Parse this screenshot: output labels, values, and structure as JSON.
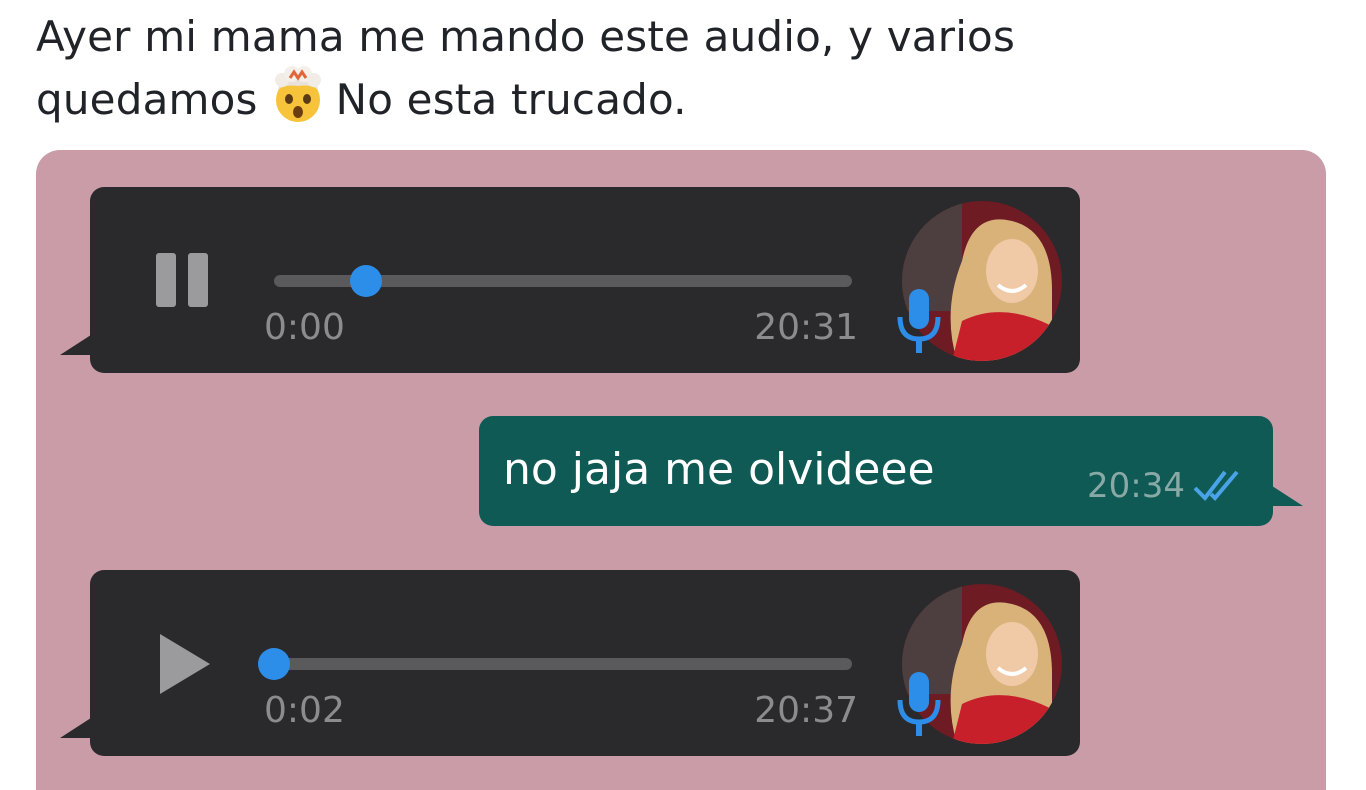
{
  "tweet": {
    "line1": "Ayer mi mama me mando este audio, y varios",
    "line2_before": "quedamos",
    "line2_after": "No esta trucado.",
    "emoji": "exploding-head-emoji"
  },
  "chat": {
    "background_color": "#c99ca7",
    "messages": [
      {
        "type": "voice",
        "state": "playing",
        "control_icon": "pause-icon",
        "elapsed": "0:00",
        "timestamp": "20:31",
        "progress": 0.16,
        "accent": "#2d8eea"
      },
      {
        "type": "text",
        "text": "no jaja me olvideee",
        "timestamp": "20:34",
        "status_icon": "double-check-icon"
      },
      {
        "type": "voice",
        "state": "paused",
        "control_icon": "play-icon",
        "elapsed": "0:02",
        "timestamp": "20:37",
        "progress": 0.0,
        "accent": "#2d8eea"
      }
    ]
  }
}
